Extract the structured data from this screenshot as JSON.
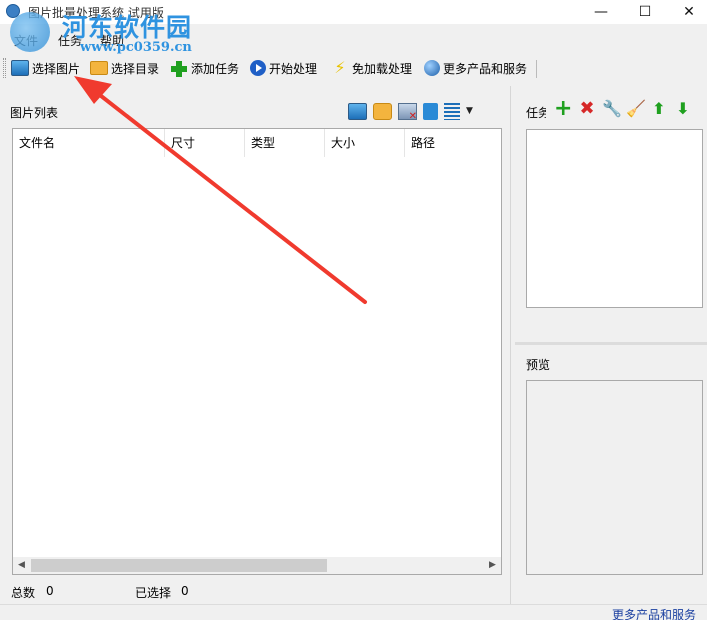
{
  "window": {
    "title": "图片批量处理系统 试用版",
    "minimize": "—",
    "maximize": "☐",
    "close": "✕"
  },
  "watermark": {
    "text1": "河东软件园",
    "text2": "www.pc0359.cn"
  },
  "menu": [
    "文件",
    "任务",
    "帮助"
  ],
  "toolbar": {
    "select_image": "选择图片",
    "select_dir": "选择目录",
    "add_task": "添加任务",
    "start": "开始处理",
    "no_load": "免加载处理",
    "more": "更多产品和服务"
  },
  "image_list": {
    "title": "图片列表",
    "columns": [
      "文件名",
      "尺寸",
      "类型",
      "大小",
      "路径"
    ],
    "rows": []
  },
  "status": {
    "total_label": "总数",
    "total_value": "0",
    "selected_label": "已选择",
    "selected_value": "0"
  },
  "task_panel": {
    "label": "任务"
  },
  "preview": {
    "label": "预览"
  },
  "footer": {
    "more_link": "更多产品和服务"
  },
  "colors": {
    "annotation_arrow": "#f03a2e",
    "link": "#1a3fa0"
  }
}
